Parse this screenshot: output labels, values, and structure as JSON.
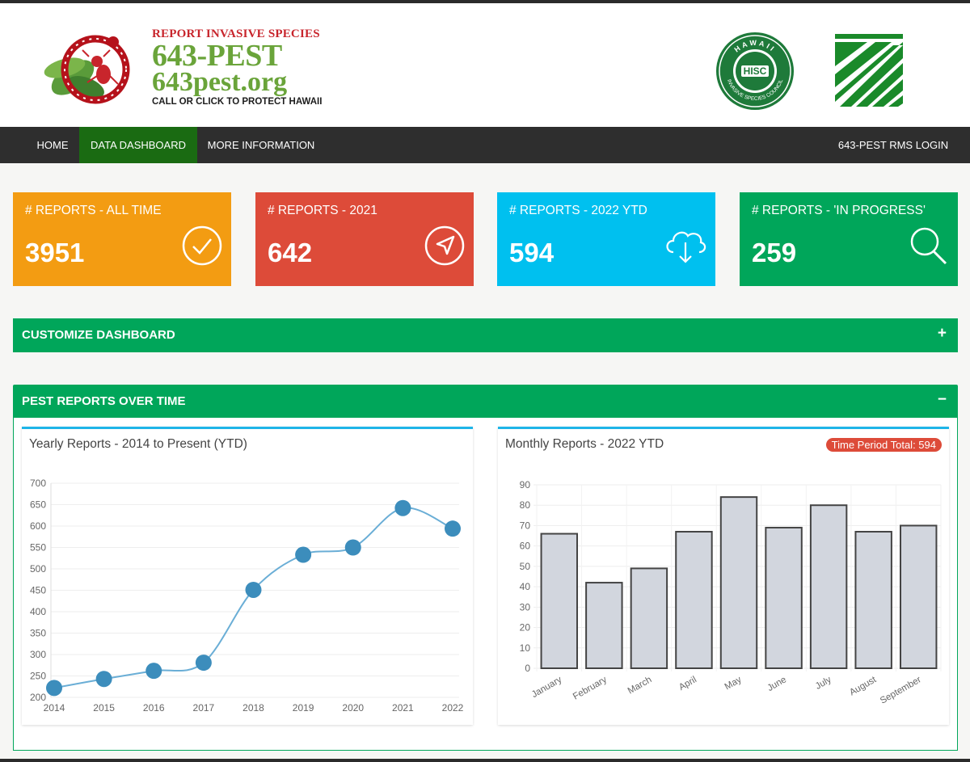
{
  "brand": {
    "tagline_top": "REPORT INVASIVE SPECIES",
    "phone": "643-PEST",
    "website": "643pest.org",
    "call_to_action": "CALL OR CLICK TO PROTECT HAWAII",
    "seal_text_top": "HAWAII",
    "seal_center": "HISC",
    "seal_text_bottom": "INVASIVE SPECIES COUNCIL"
  },
  "nav": {
    "items": [
      {
        "label": "HOME",
        "active": false
      },
      {
        "label": "DATA DASHBOARD",
        "active": true
      },
      {
        "label": "MORE INFORMATION",
        "active": false
      }
    ],
    "login": "643-PEST RMS LOGIN"
  },
  "tiles": [
    {
      "label": "# REPORTS - ALL TIME",
      "value": "3951",
      "color": "#f39c12",
      "icon": "check-circle-icon"
    },
    {
      "label": "# REPORTS - 2021",
      "value": "642",
      "color": "#dd4b39",
      "icon": "location-arrow-icon"
    },
    {
      "label": "# REPORTS - 2022 YTD",
      "value": "594",
      "color": "#00c0ef",
      "icon": "cloud-download-icon"
    },
    {
      "label": "# REPORTS - 'IN PROGRESS'",
      "value": "259",
      "color": "#00a65a",
      "icon": "search-icon"
    }
  ],
  "customize": {
    "title": "CUSTOMIZE DASHBOARD",
    "toggle": "+"
  },
  "pest_panel": {
    "title": "PEST REPORTS OVER TIME",
    "toggle": "−"
  },
  "yearly_card": {
    "title": "Yearly Reports - 2014 to Present (YTD)"
  },
  "monthly_card": {
    "title": "Monthly Reports - 2022 YTD",
    "badge": "Time Period Total:  594"
  },
  "colors": {
    "accent": "#00a65a",
    "line": "#3c8dbc",
    "bar_fill": "#d2d6de",
    "bar_stroke": "#444444"
  },
  "chart_data": [
    {
      "type": "line",
      "x": [
        "2014",
        "2015",
        "2016",
        "2017",
        "2018",
        "2019",
        "2020",
        "2021",
        "2022"
      ],
      "values": [
        222,
        243,
        262,
        281,
        451,
        533,
        550,
        642,
        594
      ],
      "ylim": [
        200,
        700
      ],
      "yticks": [
        200,
        250,
        300,
        350,
        400,
        450,
        500,
        550,
        600,
        650,
        700
      ],
      "grid": true
    },
    {
      "type": "bar",
      "categories": [
        "January",
        "February",
        "March",
        "April",
        "May",
        "June",
        "July",
        "August",
        "September"
      ],
      "values": [
        66,
        42,
        49,
        67,
        84,
        69,
        80,
        67,
        70
      ],
      "ylim": [
        0,
        90
      ],
      "yticks": [
        0,
        10,
        20,
        30,
        40,
        50,
        60,
        70,
        80,
        90
      ],
      "grid": true
    }
  ]
}
